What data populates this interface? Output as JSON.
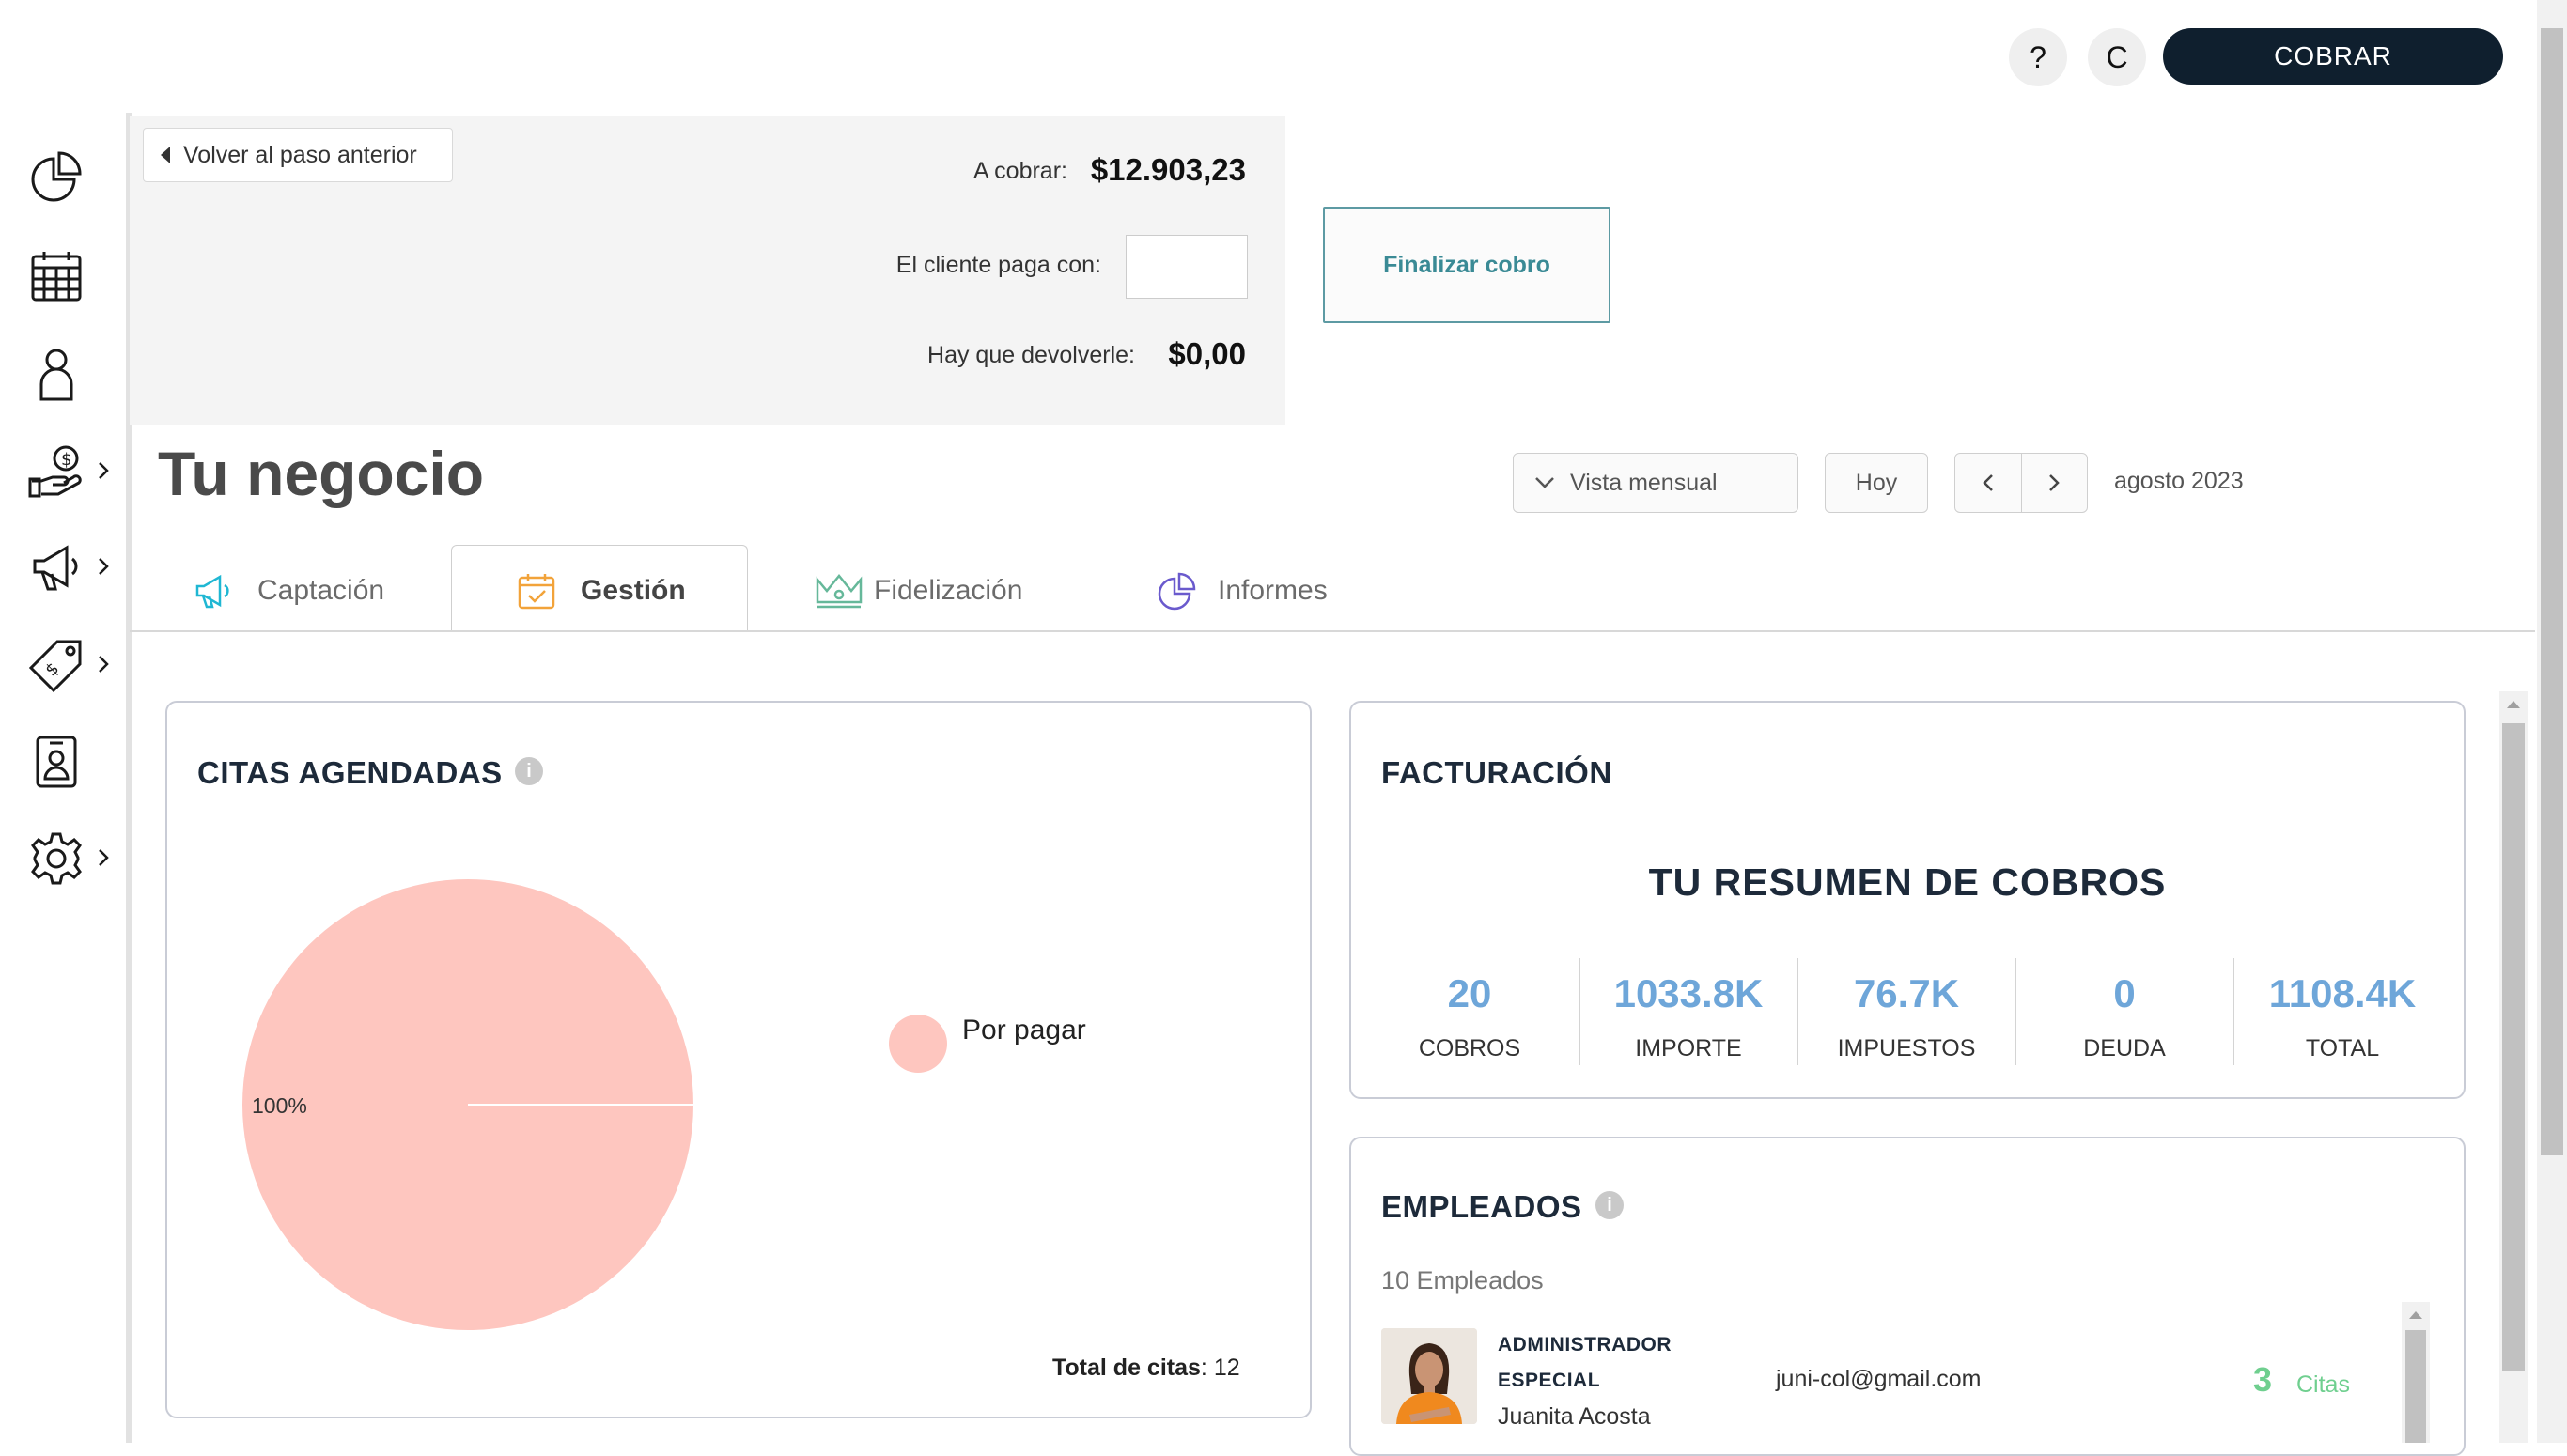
{
  "topbar": {
    "help_label": "?",
    "user_initial": "C",
    "cobrar_label": "COBRAR"
  },
  "payment": {
    "back_label": "Volver al paso anterior",
    "to_charge_label": "A cobrar:",
    "to_charge_value": "$12.903,23",
    "client_pays_label": "El cliente paga con:",
    "client_pays_value": "",
    "change_label": "Hay que devolverle:",
    "change_value": "$0,00",
    "finalize_label": "Finalizar cobro"
  },
  "header": {
    "title": "Tu negocio",
    "view_select": "Vista mensual",
    "today_label": "Hoy",
    "period_label": "agosto 2023"
  },
  "tabs": [
    {
      "label": "Captación",
      "icon": "megaphone-icon",
      "active": false
    },
    {
      "label": "Gestión",
      "icon": "calendar-check-icon",
      "active": true
    },
    {
      "label": "Fidelización",
      "icon": "crown-icon",
      "active": false
    },
    {
      "label": "Informes",
      "icon": "pie-chart-icon",
      "active": false
    }
  ],
  "citas": {
    "title": "CITAS AGENDADAS",
    "total_label": "Total de citas",
    "total_value": ": 12"
  },
  "chart_data": {
    "type": "pie",
    "slices": [
      {
        "label": "Por pagar",
        "value": 100,
        "color": "#fec6bf"
      }
    ],
    "data_labels": [
      "100%"
    ],
    "legend_position": "right"
  },
  "facturacion": {
    "title": "FACTURACIÓN",
    "subtitle": "TU RESUMEN DE COBROS",
    "stats": [
      {
        "value": "20",
        "label": "COBROS"
      },
      {
        "value": "1033.8K",
        "label": "IMPORTE"
      },
      {
        "value": "76.7K",
        "label": "IMPUESTOS"
      },
      {
        "value": "0",
        "label": "DEUDA"
      },
      {
        "value": "1108.4K",
        "label": "TOTAL"
      }
    ]
  },
  "empleados": {
    "title": "EMPLEADOS",
    "count_label": "10 Empleados",
    "rows": [
      {
        "role_line1": "ADMINISTRADOR",
        "role_line2": "ESPECIAL",
        "name": "Juanita Acosta",
        "email": "juni-col@gmail.com",
        "citas_count": "3",
        "citas_label": "Citas"
      }
    ]
  },
  "colors": {
    "accent_dark": "#0f1f2e",
    "stat_blue": "#6ea6d9",
    "pie_pink": "#fec6bf",
    "citas_green": "#6fcf8f",
    "finalize_teal": "#3a8a95"
  }
}
